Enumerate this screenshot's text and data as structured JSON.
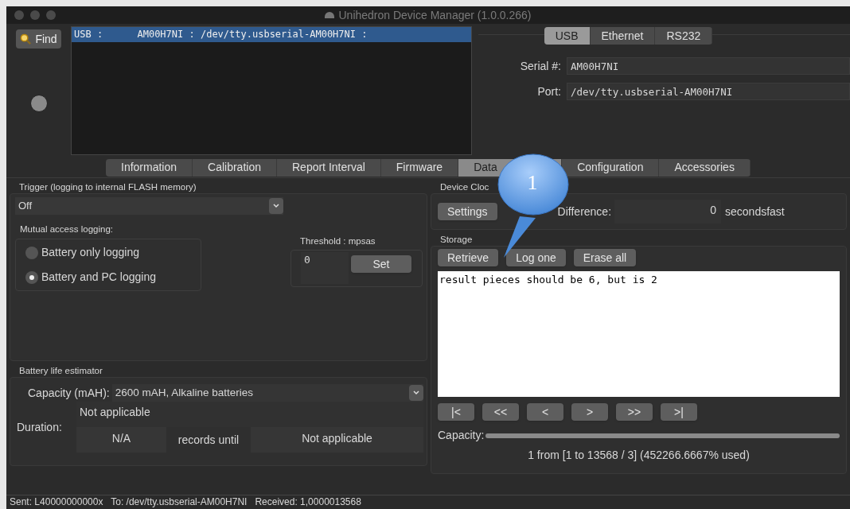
{
  "window": {
    "title": "Unihedron Device Manager  (1.0.0.266)"
  },
  "find_button": {
    "label": "Find"
  },
  "device_list": {
    "items": [
      {
        "text": "USB :      AM00H7NI : /dev/tty.usbserial-AM00H7NI :",
        "selected": true
      }
    ]
  },
  "connection_tabs": [
    {
      "label": "USB",
      "selected": true
    },
    {
      "label": "Ethernet",
      "selected": false
    },
    {
      "label": "RS232",
      "selected": false
    }
  ],
  "connection_fields": [
    {
      "label": "Serial #:",
      "value": "AM00H7NI"
    },
    {
      "label": "Port:",
      "value": "/dev/tty.usbserial-AM00H7NI"
    }
  ],
  "tabs": [
    {
      "label": "Information",
      "selected": false
    },
    {
      "label": "Calibration",
      "selected": false
    },
    {
      "label": "Report Interval",
      "selected": false
    },
    {
      "label": "Firmware",
      "selected": false
    },
    {
      "label": "Data",
      "selected": true
    },
    {
      "label": "Configuration",
      "selected": false
    },
    {
      "label": "Accessories",
      "selected": false
    }
  ],
  "trigger": {
    "title": "Trigger (logging to internal FLASH memory)",
    "value": "Off"
  },
  "mutual_access": {
    "title": "Mutual access logging:",
    "options": [
      {
        "label": "Battery only logging",
        "selected": false
      },
      {
        "label": "Battery and PC logging",
        "selected": true
      }
    ]
  },
  "threshold": {
    "title": "Threshold : mpsas",
    "value": "0",
    "button": "Set"
  },
  "battery": {
    "title": "Battery life estimator",
    "capacity_label": "Capacity (mAH):",
    "capacity_value": "2600 mAH, Alkaline batteries",
    "duration_label": "Duration:",
    "duration_value": "Not applicable",
    "records": "N/A",
    "records_label": "records until",
    "until_value": "Not applicable"
  },
  "device_clock": {
    "title": "Device Cloc",
    "button": "Settings",
    "difference_label": "Difference:",
    "difference_value": "0",
    "unit": "secondsfast"
  },
  "storage": {
    "title": "Storage",
    "buttons": [
      "Retrieve",
      "Log one",
      "Erase all"
    ],
    "log": "result pieces should be 6, but is 2",
    "nav_buttons": [
      "|<",
      "<<",
      "<",
      ">",
      ">>",
      ">|"
    ],
    "capacity_label": "Capacity:",
    "capacity": {
      "level": 1
    },
    "summary": "1 from [1 to 13568 / 3] (452266.6667% used)"
  },
  "callout": {
    "text": "1"
  },
  "status_bar": {
    "text": "Sent: L40000000000x   To: /dev/tty.usbserial-AM00H7NI   Received: 1,0000013568"
  }
}
